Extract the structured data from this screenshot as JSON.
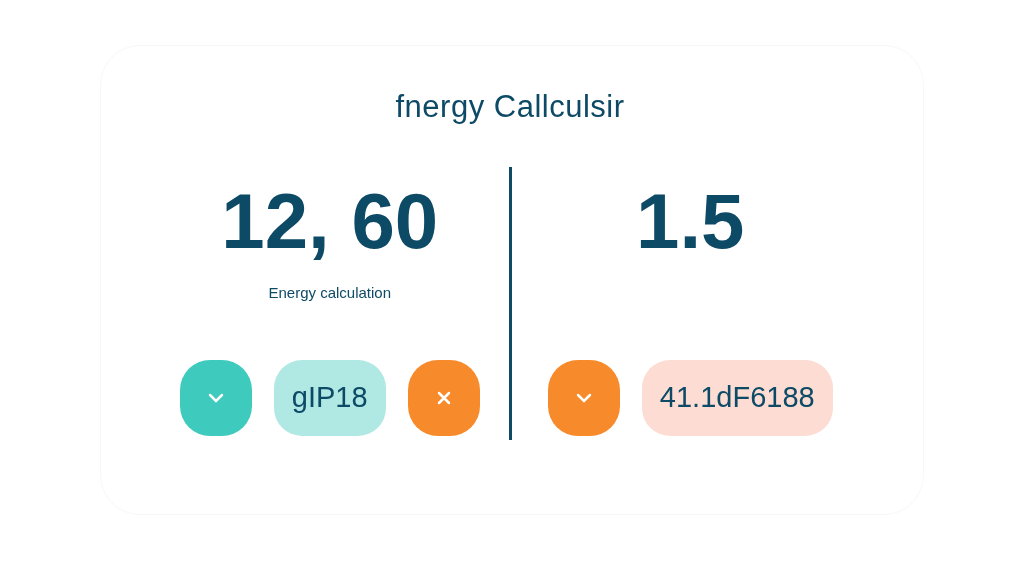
{
  "title": "fnergy Callculsir",
  "panels": [
    {
      "value": "12, 60",
      "caption": "Energy calculation",
      "controls": [
        {
          "kind": "expand",
          "color": "#3ecbbd"
        },
        {
          "kind": "chip",
          "label": "gIP18",
          "color": "#b0e8e4"
        },
        {
          "kind": "dismiss",
          "color": "#f78a2a"
        }
      ]
    },
    {
      "value": "1.5",
      "controls": [
        {
          "kind": "expand",
          "color": "#f78a2a"
        },
        {
          "kind": "chip",
          "label": "41.1dF6188",
          "color": "#fcdcd3"
        }
      ]
    }
  ]
}
